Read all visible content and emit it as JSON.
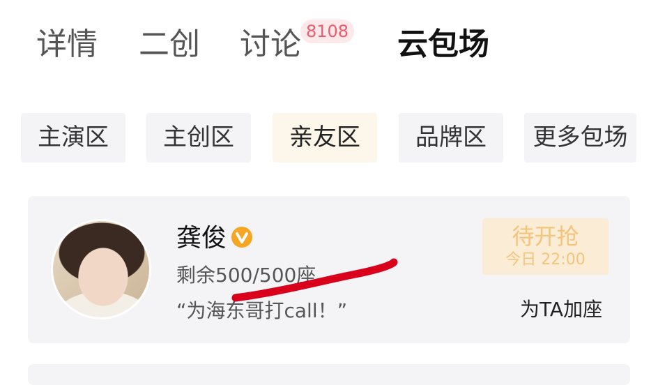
{
  "tabs": [
    {
      "label": "详情"
    },
    {
      "label": "二创"
    },
    {
      "label": "讨论",
      "badge": "8108"
    },
    {
      "label": "云包场"
    }
  ],
  "active_tab": "云包场",
  "categories": [
    {
      "label": "主演区"
    },
    {
      "label": "主创区"
    },
    {
      "label": "亲友区"
    },
    {
      "label": "品牌区"
    },
    {
      "label": "更多包场"
    }
  ],
  "active_category": "亲友区",
  "card": {
    "name": "龚俊",
    "verified_icon": "v-verified-icon",
    "remaining": "剩余500/500座",
    "slogan": "“为海东哥打call！”",
    "status_title": "待开抢",
    "status_time": "今日 22:00",
    "add_seat_label": "为TA加座"
  },
  "colors": {
    "badge_bg": "#fde8ea",
    "badge_text": "#ef5a6e",
    "active_chip_bg": "#fdf6ea",
    "status_bg": "#fbecd6",
    "status_text": "#f3c47c",
    "verified": "#f5a623",
    "scribble": "#d9001b"
  }
}
